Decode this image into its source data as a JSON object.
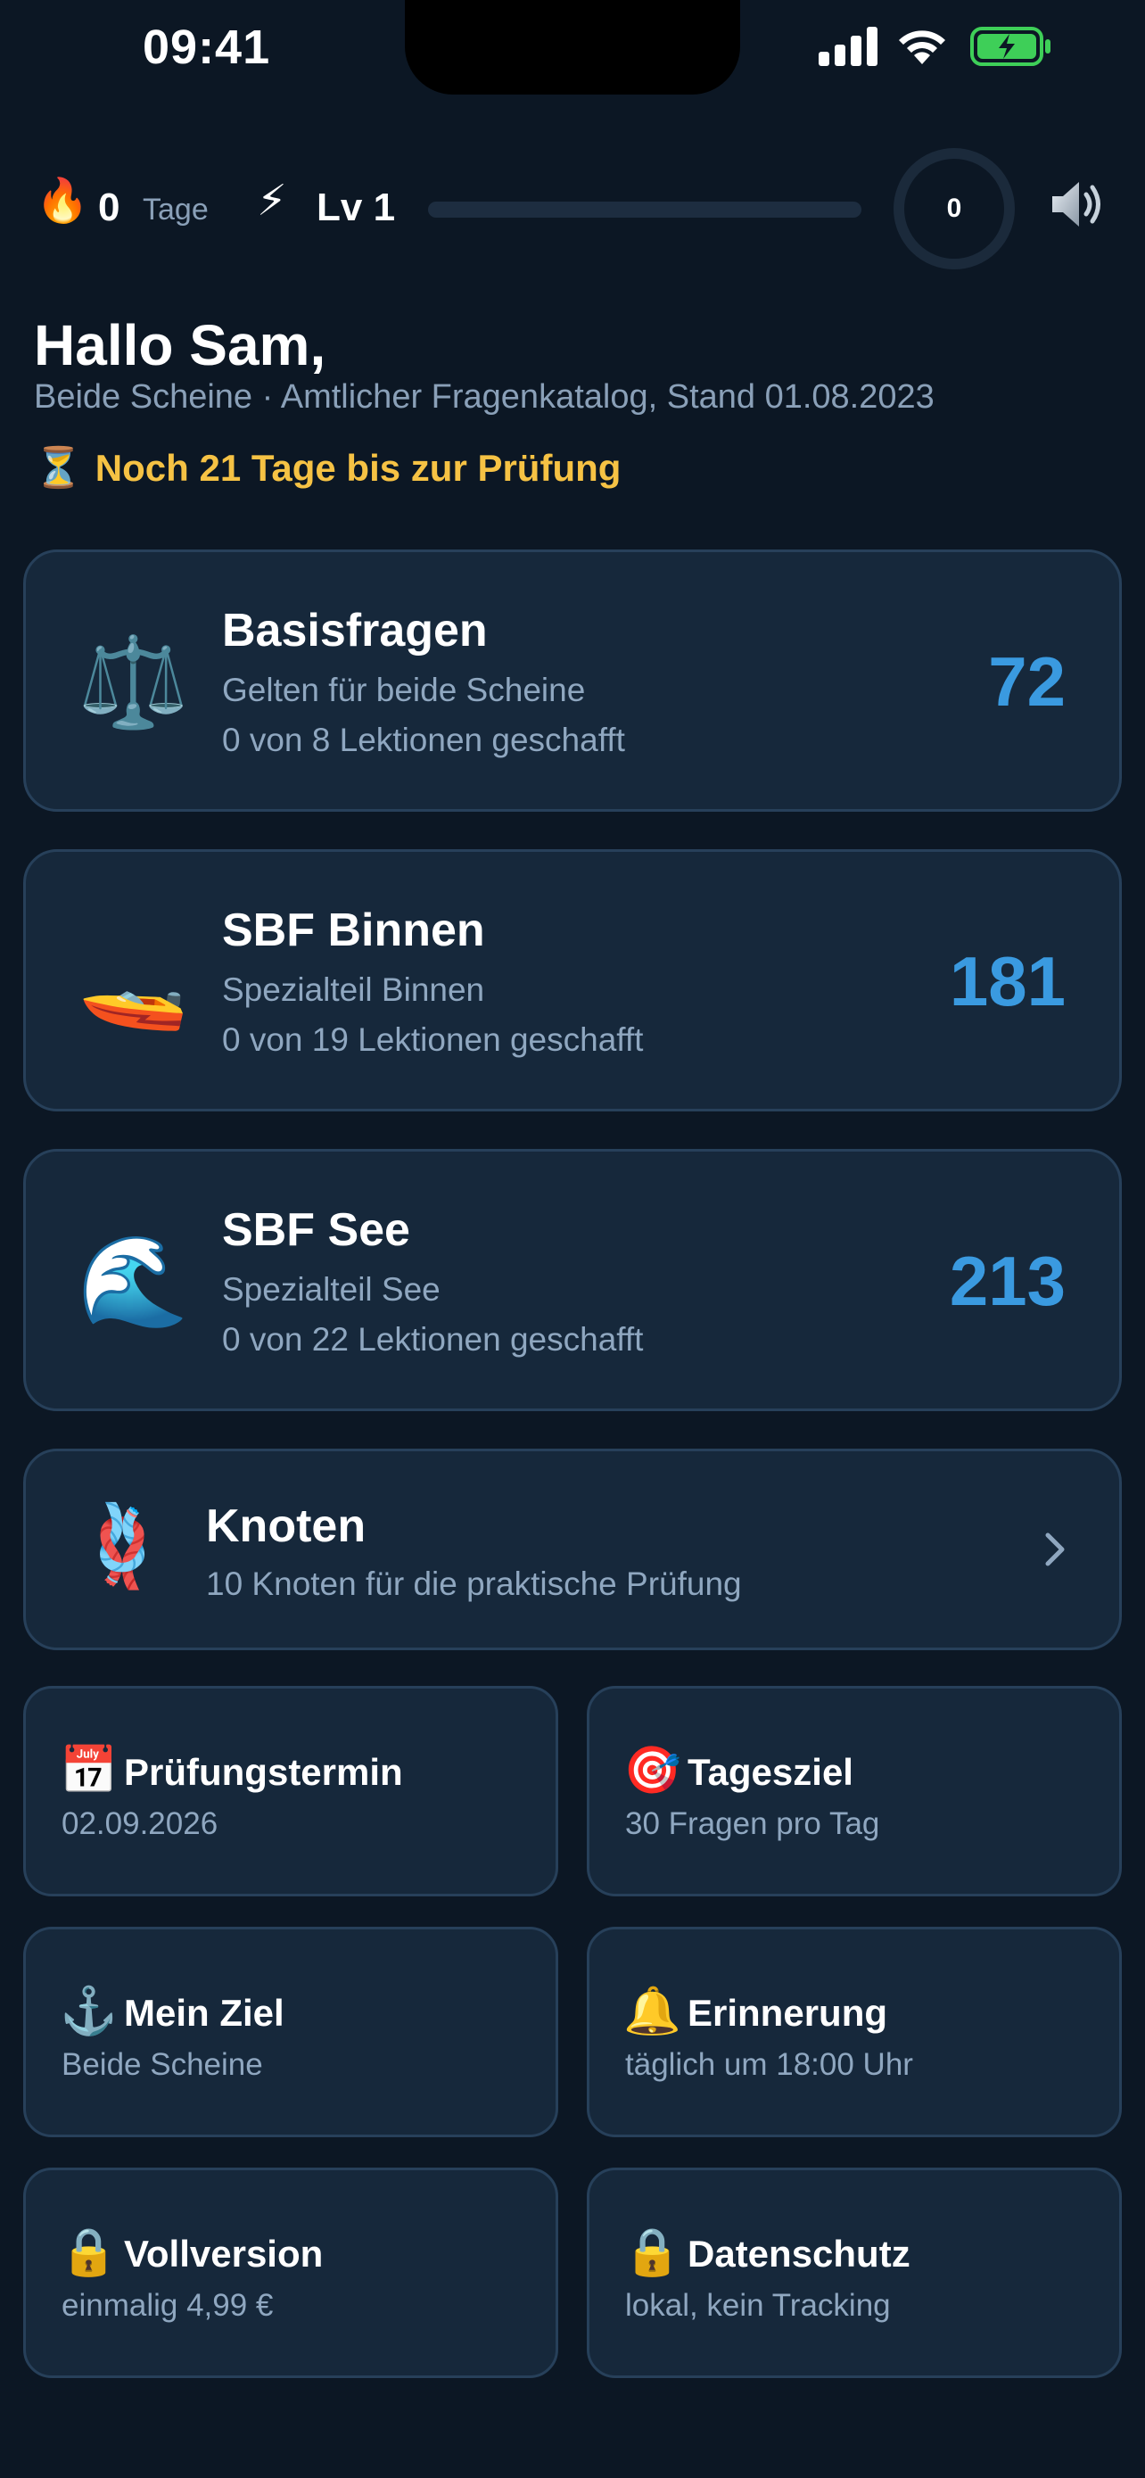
{
  "status_bar": {
    "time": "09:41"
  },
  "header": {
    "streak_value": "0",
    "streak_unit": "Tage",
    "level_label": "Lv 1",
    "xp_progress": 0,
    "ring_value": "0",
    "streak_icon": "fire-icon",
    "level_icon": "lightning-icon",
    "sound_icon": "speaker-icon"
  },
  "greeting": {
    "title": "Hallo Sam,",
    "subtitle": "Beide Scheine · Amtlicher Fragenkatalog, Stand 01.08.2023",
    "countdown": "Noch 21 Tage bis zur Prüfung",
    "countdown_icon": "⏳"
  },
  "topics": [
    {
      "icon": "⚖️",
      "title": "Basisfragen",
      "line1": "Gelten für beide Scheine",
      "line2": "0 von 8 Lektionen geschafft",
      "count": "72"
    },
    {
      "icon": "🚤",
      "title": "SBF Binnen",
      "line1": "Spezialteil Binnen",
      "line2": "0 von 19 Lektionen geschafft",
      "count": "181"
    },
    {
      "icon": "🌊",
      "title": "SBF See",
      "line1": "Spezialteil See",
      "line2": "0 von 22 Lektionen geschafft",
      "count": "213"
    }
  ],
  "knots": {
    "icon": "🪢",
    "title": "Knoten",
    "subtitle": "10 Knoten für die praktische Prüfung"
  },
  "tiles": [
    {
      "icon": "📅",
      "title": "Prüfungstermin",
      "subtitle": "02.09.2026"
    },
    {
      "icon": "🎯",
      "title": "Tagesziel",
      "subtitle": "30 Fragen pro Tag"
    },
    {
      "icon": "⚓️",
      "title": "Mein Ziel",
      "subtitle": "Beide Scheine"
    },
    {
      "icon": "🔔",
      "title": "Erinnerung",
      "subtitle": "täglich um 18:00 Uhr"
    },
    {
      "icon": "🔒",
      "title": "Vollversion",
      "subtitle": "einmalig 4,99 €"
    },
    {
      "icon": "🔒",
      "title": "Datenschutz",
      "subtitle": "lokal, kein Tracking"
    }
  ],
  "colors": {
    "background": "#0c1724",
    "card": "#16283b",
    "accent": "#3a9ae0",
    "countdown": "#f6c244"
  }
}
